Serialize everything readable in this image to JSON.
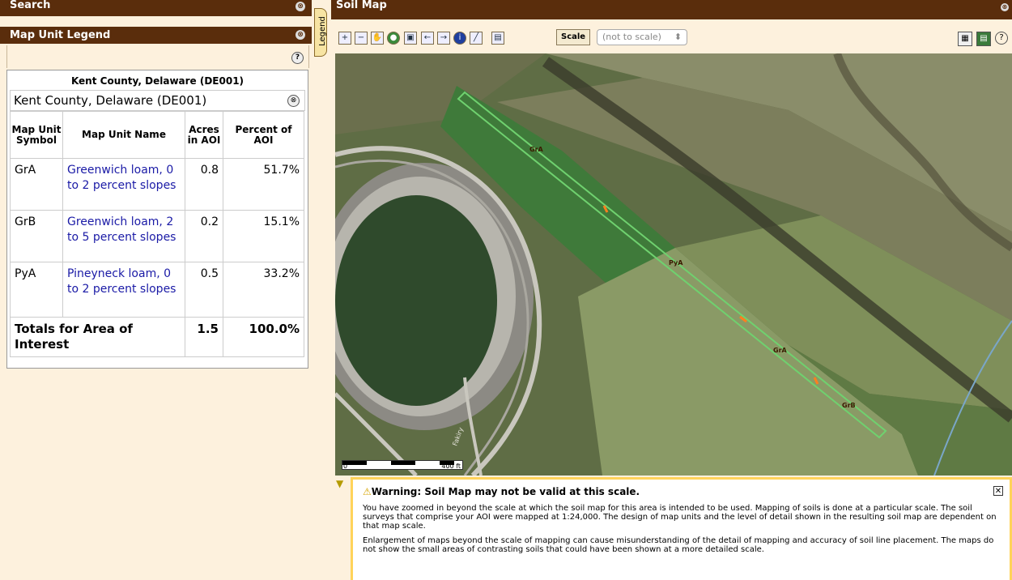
{
  "left_panel": {
    "search_title": "Search",
    "legend_title": "Map Unit Legend",
    "collapse_icon": "⊗",
    "help_icon": "?",
    "table_title": "Kent County, Delaware (DE001)",
    "area_name": "Kent County, Delaware (DE001)",
    "area_collapse_icon": "⊗",
    "headers": {
      "symbol": "Map Unit Symbol",
      "name": "Map Unit Name",
      "acres": "Acres in AOI",
      "percent": "Percent of AOI"
    },
    "rows": [
      {
        "symbol": "GrA",
        "name": "Greenwich loam, 0 to 2 percent slopes",
        "acres": "0.8",
        "percent": "51.7%"
      },
      {
        "symbol": "GrB",
        "name": "Greenwich loam, 2 to 5 percent slopes",
        "acres": "0.2",
        "percent": "15.1%"
      },
      {
        "symbol": "PyA",
        "name": "Pineyneck loam, 0 to 2 percent slopes",
        "acres": "0.5",
        "percent": "33.2%"
      }
    ],
    "totals": {
      "label": "Totals for Area of Interest",
      "acres": "1.5",
      "percent": "100.0%"
    }
  },
  "legend_tab": "Legend",
  "soil_map": {
    "title": "Soil Map",
    "scale_button": "Scale",
    "scale_select": "(not to scale)",
    "scale_select_arrow": "⬍",
    "map_labels": [
      "GrA",
      "PyA",
      "GrA",
      "GrB"
    ],
    "scalebar_start": "0",
    "scalebar_end": "400 ft",
    "road_label": "Fakiry"
  },
  "toolbar_icons": [
    "zoom-in-icon",
    "zoom-out-icon",
    "pan-icon",
    "full-extent-icon",
    "zoom-aoi-icon",
    "back-icon",
    "forward-icon",
    "identify-icon",
    "measure-icon",
    "export-icon"
  ],
  "warning": {
    "title": "Warning: Soil Map may not be valid at this scale.",
    "paragraph1": "You have zoomed in beyond the scale at which the soil map for this area is intended to be used. Mapping of soils is done at a particular scale. The soil surveys that comprise your AOI were mapped at 1:24,000. The design of map units and the level of detail shown in the resulting soil map are dependent on that map scale.",
    "paragraph2": "Enlargement of maps beyond the scale of mapping can cause misunderstanding of the detail of mapping and accuracy of soil line placement. The maps do not show the small areas of contrasting soils that could have been shown at a more detailed scale.",
    "close_icon": "✕"
  },
  "colors": {
    "header_brown": "#5a2d0c",
    "panel_bg": "#fdf1dd",
    "link_blue": "#1a1aa6",
    "aoi_green": "#6fd16f",
    "warning_border": "#ffd35a"
  }
}
